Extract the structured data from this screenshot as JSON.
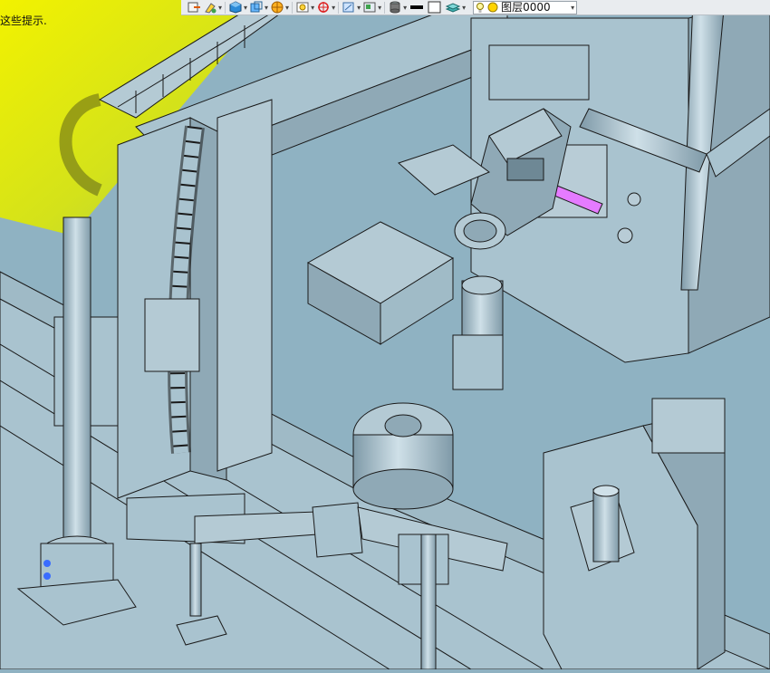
{
  "hint_text": "这些提示.",
  "layer": {
    "current": "图层0000"
  },
  "colors": {
    "model_fill": "#a9c3cf",
    "model_dark": "#7f9aa8",
    "background_yellow": "#f2f200",
    "background_green": "#c8d832",
    "highlight": "#e57bff",
    "toolbar_bg": "#e9ecef"
  },
  "toolbar": {
    "icons": [
      "export-icon",
      "sketch-icon",
      "cube-icon",
      "view-icon",
      "render-icon",
      "snapshot-icon",
      "axis-icon",
      "section-icon",
      "display-icon",
      "material-icon",
      "line-color-icon",
      "fill-color-icon",
      "layer-icon"
    ]
  }
}
